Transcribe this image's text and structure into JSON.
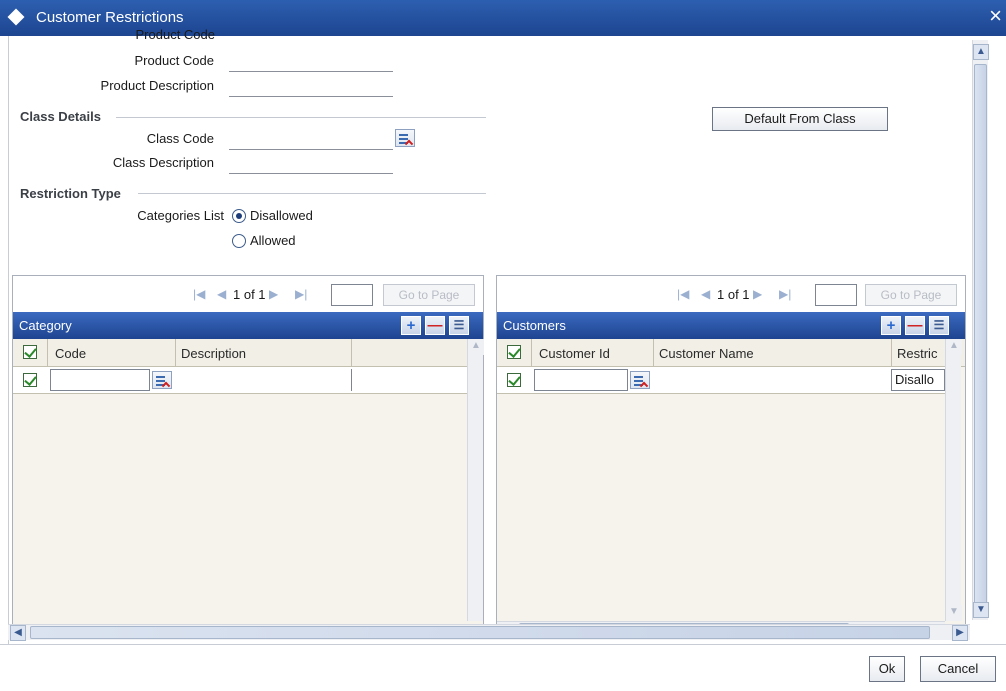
{
  "window": {
    "title": "Customer Restrictions",
    "close_icon": "×"
  },
  "product": {
    "code_label": "Product Code",
    "code_value": "",
    "desc_label": "Product Description",
    "desc_value": ""
  },
  "class_details": {
    "section_title": "Class Details",
    "code_label": "Class Code",
    "code_value": "",
    "desc_label": "Class Description",
    "desc_value": "",
    "default_button": "Default From Class"
  },
  "restriction": {
    "section_title": "Restriction Type",
    "list_label": "Categories List",
    "options": [
      "Disallowed",
      "Allowed"
    ],
    "selected": "Disallowed"
  },
  "category_grid": {
    "pager_text": "1 of 1",
    "page_input": "",
    "goto_label": "Go to Page",
    "title": "Category",
    "columns": [
      "Code",
      "Description"
    ],
    "rows": [
      {
        "code": "",
        "description": ""
      }
    ]
  },
  "customers_grid": {
    "pager_text": "1 of 1",
    "page_input": "",
    "goto_label": "Go to Page",
    "title": "Customers",
    "columns": [
      "Customer Id",
      "Customer Name",
      "Restric"
    ],
    "rows": [
      {
        "customer_id": "",
        "customer_name": "",
        "restriction": "Disallo"
      }
    ]
  },
  "footer": {
    "ok_label": "Ok",
    "cancel_label": "Cancel"
  },
  "colors": {
    "title_bar": "#2d5fb0",
    "grid_header": "#2f5aa8",
    "grid_body": "#f5f3ec"
  }
}
